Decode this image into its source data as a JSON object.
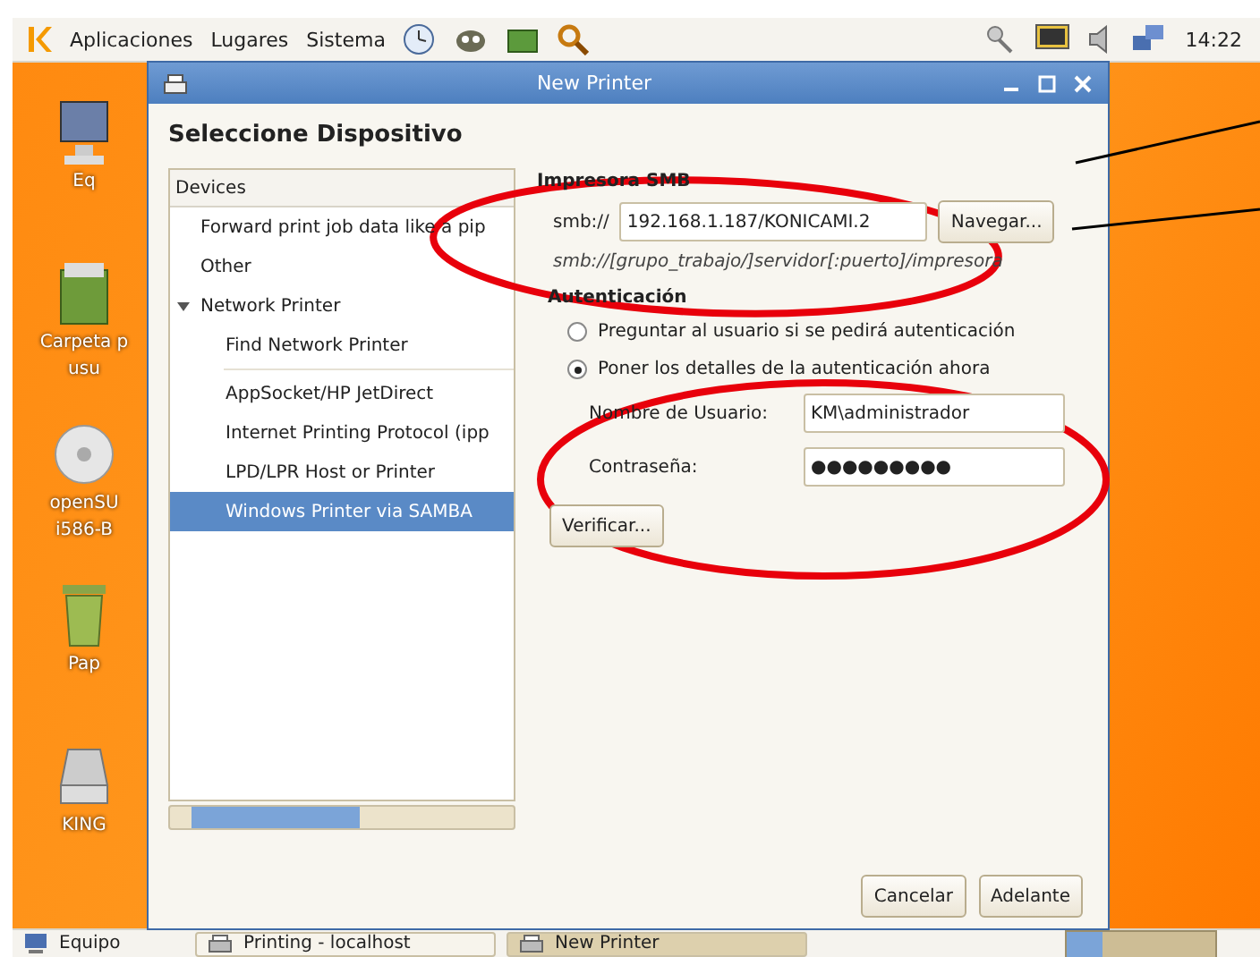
{
  "top_panel": {
    "menus": [
      "Aplicaciones",
      "Lugares",
      "Sistema"
    ],
    "clock": "14:22"
  },
  "desktop_icons": [
    {
      "kind": "monitor",
      "label": [
        "Eq"
      ]
    },
    {
      "kind": "folder",
      "label": [
        "Carpeta p",
        "usu"
      ]
    },
    {
      "kind": "disc",
      "label": [
        "openSU",
        "i586-B"
      ]
    },
    {
      "kind": "trash",
      "label": [
        "Pap"
      ]
    },
    {
      "kind": "drive",
      "label": [
        "KING"
      ]
    }
  ],
  "window": {
    "title": "New Printer",
    "heading": "Seleccione Dispositivo",
    "devices": {
      "header": "Devices",
      "items": [
        {
          "label": "Forward print job data like a pip",
          "selected": false
        },
        {
          "label": "Other",
          "selected": false
        },
        {
          "label": "Network Printer",
          "selected": false,
          "expanded": true,
          "children": [
            {
              "label": "Find Network Printer",
              "selected": false
            },
            {
              "label": "AppSocket/HP JetDirect",
              "selected": false
            },
            {
              "label": "Internet Printing Protocol (ipp",
              "selected": false
            },
            {
              "label": "LPD/LPR Host or Printer",
              "selected": false
            },
            {
              "label": "Windows Printer via SAMBA",
              "selected": true
            }
          ]
        }
      ]
    },
    "smb": {
      "title": "Impresora SMB",
      "prefix": "smb://",
      "value": "192.168.1.187/KONICAMI.2",
      "browse": "Navegar...",
      "hint": "smb://[grupo_trabajo/]servidor[:puerto]/impresora"
    },
    "auth": {
      "title": "Autenticación",
      "options": [
        {
          "label": "Preguntar al usuario si se pedirá autenticación",
          "selected": false
        },
        {
          "label": "Poner los detalles de la autenticación ahora",
          "selected": true
        }
      ],
      "username_label": "Nombre de Usuario:",
      "username": "KM\\administrador",
      "password_label": "Contraseña:",
      "password": "●●●●●●●●●",
      "verify": "Verificar..."
    },
    "buttons": [
      "Cancelar",
      "Adelante"
    ]
  },
  "taskbar": {
    "start": "Equipo",
    "tasks": [
      {
        "label": "Printing - localhost",
        "selected": false
      },
      {
        "label": "New Printer",
        "selected": true
      }
    ]
  }
}
